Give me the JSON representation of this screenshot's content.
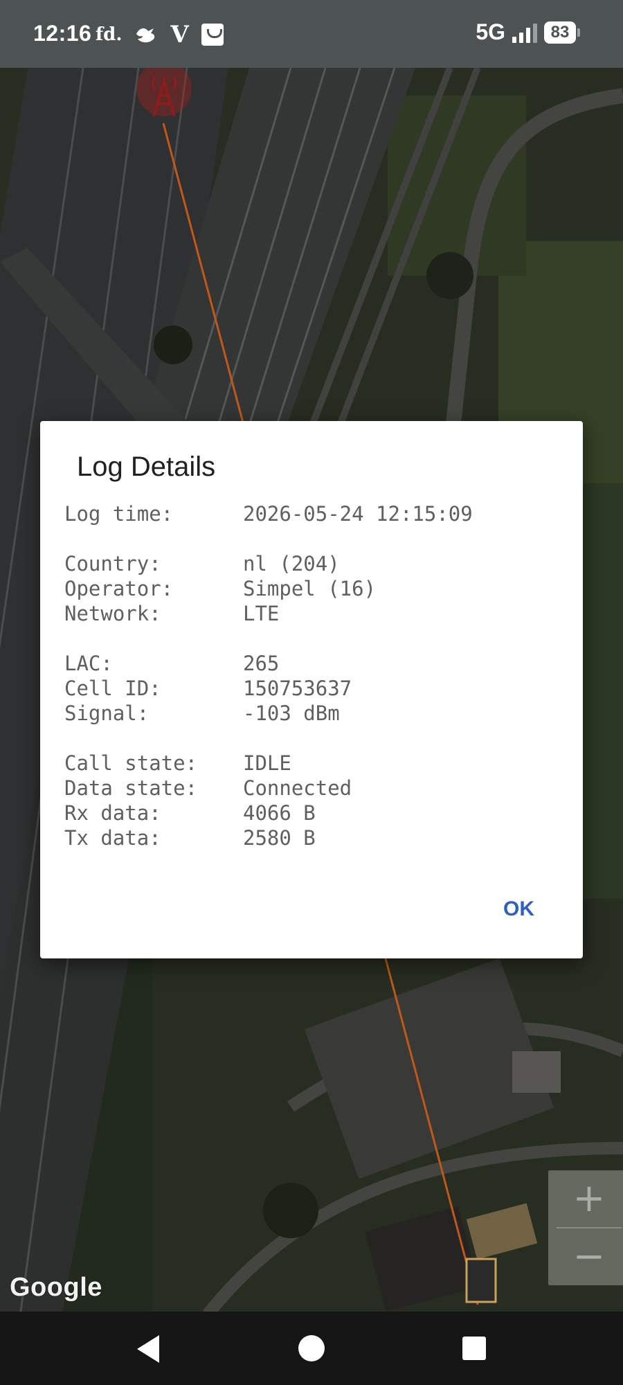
{
  "status_bar": {
    "time": "12:16",
    "left_icons": [
      "fd.",
      "bird-icon",
      "V",
      "tv-icon"
    ],
    "fd_text": "fd.",
    "v_text": "V",
    "network": "5G",
    "signal_level": 0.75,
    "battery": "83"
  },
  "map": {
    "attribution": "Google",
    "zoom_in_label": "+",
    "zoom_out_label": "−",
    "cell_tower_icon": "cell-tower-icon",
    "link_line_color": "#d2691e"
  },
  "dialog": {
    "title": "Log Details",
    "rows": {
      "log_time": {
        "label": "Log time:",
        "value": "2026-05-24 12:15:09"
      },
      "country": {
        "label": "Country:",
        "value": "nl (204)"
      },
      "operator": {
        "label": "Operator:",
        "value": "Simpel (16)"
      },
      "network": {
        "label": "Network:",
        "value": "LTE"
      },
      "lac": {
        "label": "LAC:",
        "value": "265"
      },
      "cell_id": {
        "label": "Cell ID:",
        "value": "150753637"
      },
      "signal": {
        "label": "Signal:",
        "value": "-103 dBm"
      },
      "call_state": {
        "label": "Call state:",
        "value": "IDLE"
      },
      "data_state": {
        "label": "Data state:",
        "value": "Connected"
      },
      "rx_data": {
        "label": "Rx data:",
        "value": "4066 B"
      },
      "tx_data": {
        "label": "Tx data:",
        "value": "2580 B"
      }
    },
    "ok_label": "OK"
  },
  "colors": {
    "accent": "#2f5fbf",
    "status_bar": "#4d5353",
    "nav_bar": "#151515"
  }
}
